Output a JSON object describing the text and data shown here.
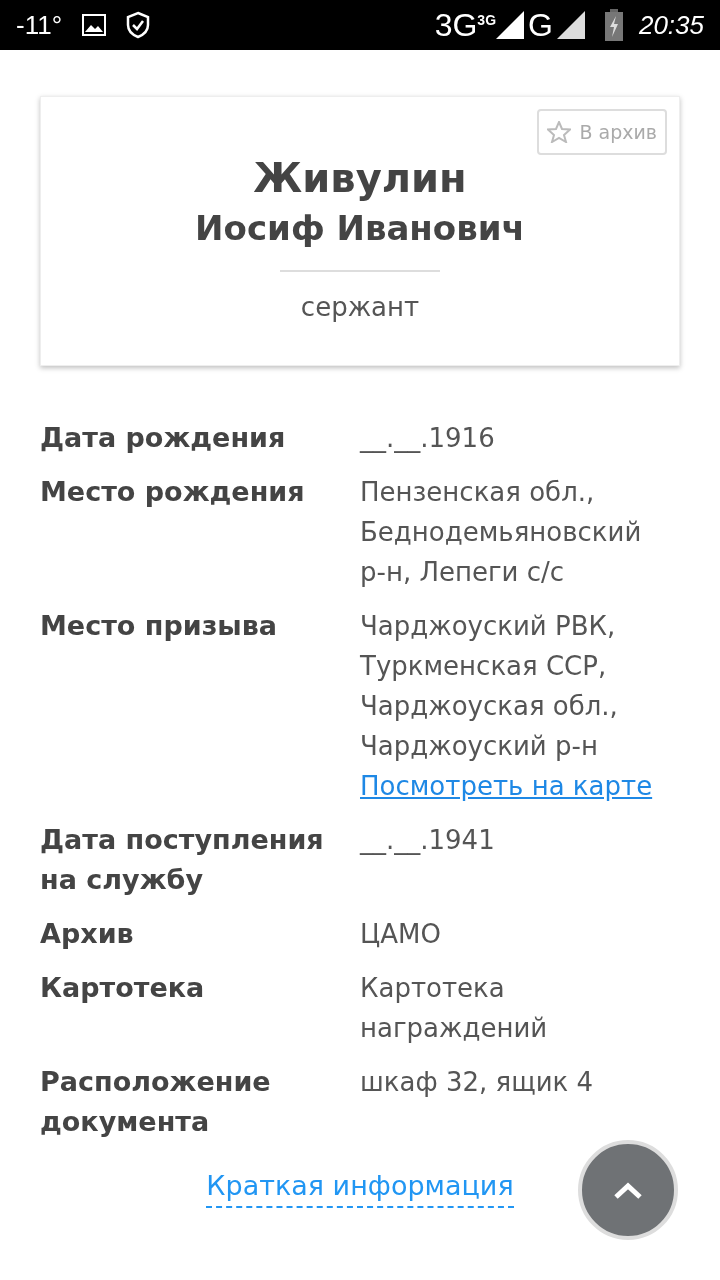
{
  "status_bar": {
    "temperature": "-11°",
    "network_1": "3G",
    "network_1_sup": "3G",
    "network_2": "G",
    "time": "20:35"
  },
  "card": {
    "archive_button": "В архив",
    "surname": "Живулин",
    "given_names": "Иосиф Иванович",
    "rank": "сержант"
  },
  "fields": [
    {
      "label": "Дата рождения",
      "value": "__.__.1916"
    },
    {
      "label": "Место рождения",
      "value": "Пензенская обл., Беднодемьяновский р-н, Лепеги с/с"
    },
    {
      "label": "Место призыва",
      "value": "Чарджоуский РВК, Туркменская ССР, Чарджоуская обл., Чарджоуский р-н",
      "link": "Посмотреть на карте"
    },
    {
      "label": "Дата поступления на службу",
      "value": "__.__.1941"
    },
    {
      "label": "Архив",
      "value": "ЦАМО"
    },
    {
      "label": "Картотека",
      "value": "Картотека награждений"
    },
    {
      "label": "Расположение документа",
      "value": "шкаф 32, ящик 4"
    }
  ],
  "summary_link": "Краткая информация"
}
